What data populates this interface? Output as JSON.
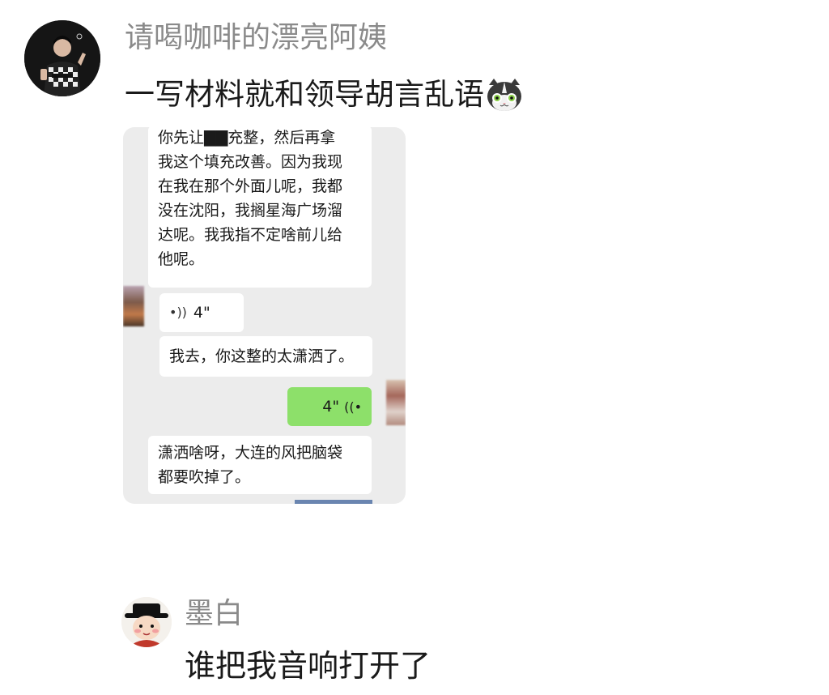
{
  "post": {
    "username": "请喝咖啡的漂亮阿姨",
    "text": "一写材料就和领导胡言乱语",
    "emoji": "cat-face-emoji"
  },
  "chat_screenshot": {
    "message_1_lines": [
      "你先让▇▇充整，然后再拿",
      "我这个填充改善。因为我现",
      "在我在那个外面儿呢，我都",
      "没在沈阳，我搁星海广场溜",
      "达呢。我我指不定啥前儿给",
      "他呢。"
    ],
    "voice_in_duration": "4\"",
    "message_2": "我去，你这整的太潇洒了。",
    "voice_out_duration": "4\"",
    "message_3_lines": [
      "潇洒啥呀，大连的风把脑袋",
      "都要吹掉了。"
    ]
  },
  "reply": {
    "username": "墨白",
    "text": "谁把我音响打开了"
  },
  "colors": {
    "username": "#8a8a8a",
    "text": "#1a1a1a",
    "chat_bg": "#ececec",
    "outgoing_bubble": "#8de06a",
    "incoming_bubble": "#ffffff"
  }
}
